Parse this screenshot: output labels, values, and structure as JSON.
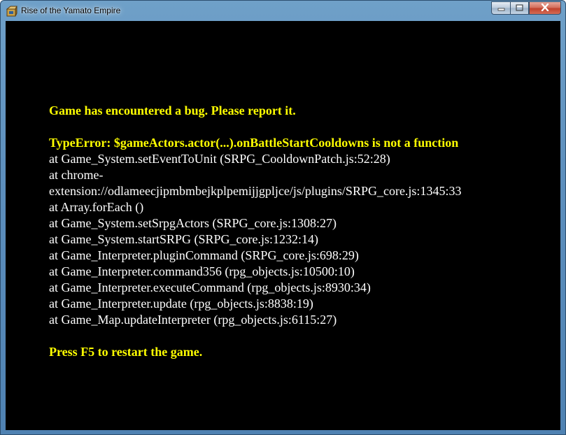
{
  "window": {
    "title": "Rise of the Yamato Empire",
    "app_icon": "rpg-maker-app-icon",
    "buttons": {
      "minimize_icon": "minimize-icon",
      "maximize_icon": "maximize-icon",
      "close_icon": "close-icon"
    }
  },
  "colors": {
    "background": "#000000",
    "header_text": "#ffff00",
    "stack_text": "#ffffff",
    "titlebar": "#5d8fbd",
    "close_button": "#c7503c"
  },
  "error": {
    "header": "Game has encountered a bug. Please report it.",
    "type_error": "TypeError: $gameActors.actor(...).onBattleStartCooldowns is not a function",
    "stack": [
      "at Game_System.setEventToUnit (SRPG_CooldownPatch.js:52:28)",
      "at chrome-",
      "extension://odlameecjipmbmbejkplpemijjgpljce/js/plugins/SRPG_core.js:1345:33",
      "at Array.forEach ()",
      "at Game_System.setSrpgActors (SRPG_core.js:1308:27)",
      "at Game_System.startSRPG (SRPG_core.js:1232:14)",
      "at Game_Interpreter.pluginCommand (SRPG_core.js:698:29)",
      "at Game_Interpreter.command356 (rpg_objects.js:10500:10)",
      "at Game_Interpreter.executeCommand (rpg_objects.js:8930:34)",
      "at Game_Interpreter.update (rpg_objects.js:8838:19)",
      "at Game_Map.updateInterpreter (rpg_objects.js:6115:27)"
    ],
    "footer": "Press F5 to restart the game."
  }
}
